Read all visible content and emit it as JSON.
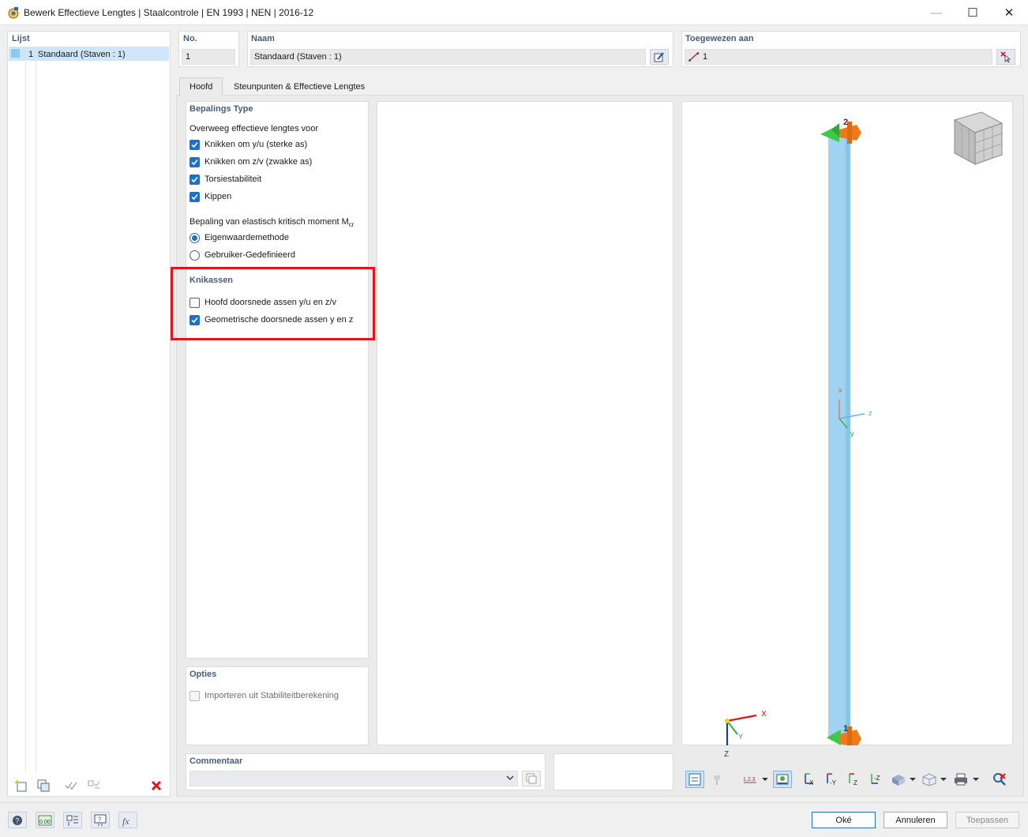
{
  "window": {
    "title": "Bewerk Effectieve Lengtes | Staalcontrole | EN 1993 | NEN | 2016-12",
    "minimize": "—",
    "maximize": "☐",
    "close": "✕"
  },
  "list": {
    "header": "Lijst",
    "items": [
      {
        "number": "1",
        "label": "Standaard (Staven : 1)",
        "color": "#8ec9ef"
      }
    ]
  },
  "fields": {
    "no_label": "No.",
    "no_value": "1",
    "name_label": "Naam",
    "name_value": "Standaard (Staven : 1)",
    "assigned_label": "Toegewezen aan",
    "assigned_value": "1"
  },
  "tabs": [
    {
      "label": "Hoofd",
      "active": true
    },
    {
      "label": "Steunpunten & Effectieve Lengtes",
      "active": false
    }
  ],
  "bepalings": {
    "header": "Bepalings Type",
    "consider_label": "Overweeg effectieve lengtes voor",
    "options": [
      {
        "label": "Knikken om y/u (sterke as)",
        "checked": true
      },
      {
        "label": "Knikken om z/v (zwakke as)",
        "checked": true
      },
      {
        "label": "Torsiestabiliteit",
        "checked": true
      },
      {
        "label": "Kippen",
        "checked": true
      }
    ],
    "mcr_label": "Bepaling van elastisch kritisch moment M",
    "mcr_sub": "cr",
    "mcr_options": [
      {
        "label": "Eigenwaardemethode",
        "selected": true
      },
      {
        "label": "Gebruiker-Gedefinieerd",
        "selected": false
      }
    ]
  },
  "knikassen": {
    "header": "Knikassen",
    "options": [
      {
        "label": "Hoofd doorsnede assen y/u en z/v",
        "checked": false
      },
      {
        "label": "Geometrische doorsnede assen y en z",
        "checked": true
      }
    ],
    "highlight_color": "#e0161b"
  },
  "opties": {
    "header": "Opties",
    "import_label": "Importeren uit Stabiliteitberekening",
    "import_checked": false,
    "disabled": true
  },
  "commentaar": {
    "header": "Commentaar",
    "value": ""
  },
  "view3d": {
    "node_top": "2",
    "node_bottom": "1",
    "local_axes": {
      "x": "x",
      "y": "y",
      "z": "z"
    },
    "global_axes": {
      "x": "X",
      "y": "Y",
      "z": "Z"
    },
    "member_color": "#9fd3f1",
    "support_green": "#3ec94a",
    "support_orange": "#ef7a1a"
  },
  "buttons": {
    "ok": "Oké",
    "cancel": "Annuleren",
    "apply": "Toepassen"
  },
  "toolbar_icons": {
    "list": [
      "new-item-icon",
      "copy-item-icon",
      "check-all-icon",
      "uncheck-icon",
      "delete-icon"
    ],
    "view": [
      "zoom-all-icon",
      "render-icon",
      "numbering-icon",
      "visibility-icon",
      "view-x-icon",
      "view-minus-y-icon",
      "view-z-icon",
      "view-minus-z-icon",
      "display-style-icon",
      "iso-view-icon",
      "print-icon",
      "reset-view-icon"
    ],
    "footer": [
      "help-icon",
      "units-icon",
      "filter-icon",
      "info-icon",
      "formula-icon"
    ]
  }
}
